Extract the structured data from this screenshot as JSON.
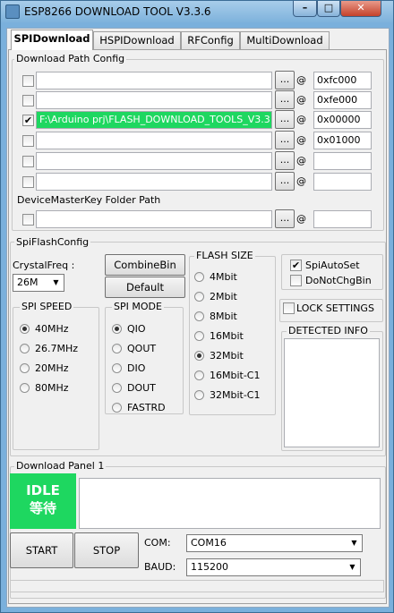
{
  "window": {
    "title": "ESP8266 DOWNLOAD TOOL V3.3.6",
    "min": "–",
    "max": "□",
    "close": "✕"
  },
  "tabs": [
    "SPIDownload",
    "HSPIDownload",
    "RFConfig",
    "MultiDownload"
  ],
  "download_path": {
    "label": "Download Path Config",
    "rows": [
      {
        "checked": "",
        "path": "",
        "addr": "0xfc000"
      },
      {
        "checked": "",
        "path": "",
        "addr": "0xfe000"
      },
      {
        "checked": "✔",
        "path": "F:\\Arduino prj\\FLASH_DOWNLOAD_TOOLS_V3.3",
        "addr": "0x00000"
      },
      {
        "checked": "",
        "path": "",
        "addr": "0x01000"
      },
      {
        "checked": "",
        "path": "",
        "addr": ""
      },
      {
        "checked": "",
        "path": "",
        "addr": ""
      }
    ],
    "browse": "...",
    "at": "@"
  },
  "device_key": {
    "label": "DeviceMasterKey Folder Path",
    "path": "",
    "addr": ""
  },
  "spiflash": {
    "label": "SpiFlashConfig",
    "crystal_label": "CrystalFreq :",
    "crystal_value": "26M",
    "combine_btn": "CombineBin",
    "default_btn": "Default",
    "speed_label": "SPI SPEED",
    "speeds": [
      "40MHz",
      "26.7MHz",
      "20MHz",
      "80MHz"
    ],
    "mode_label": "SPI MODE",
    "modes": [
      "QIO",
      "QOUT",
      "DIO",
      "DOUT",
      "FASTRD"
    ],
    "size_label": "FLASH SIZE",
    "sizes": [
      "4Mbit",
      "2Mbit",
      "8Mbit",
      "16Mbit",
      "32Mbit",
      "16Mbit-C1",
      "32Mbit-C1"
    ],
    "spiautoset": "SpiAutoSet",
    "donotchg": "DoNotChgBin",
    "lock": "LOCK SETTINGS",
    "detected": "DETECTED INFO"
  },
  "download_panel": {
    "label": "Download Panel 1",
    "status_en": "IDLE",
    "status_cn": "等待",
    "start": "START",
    "stop": "STOP",
    "com_label": "COM:",
    "com_value": "COM16",
    "baud_label": "BAUD:",
    "baud_value": "115200"
  }
}
